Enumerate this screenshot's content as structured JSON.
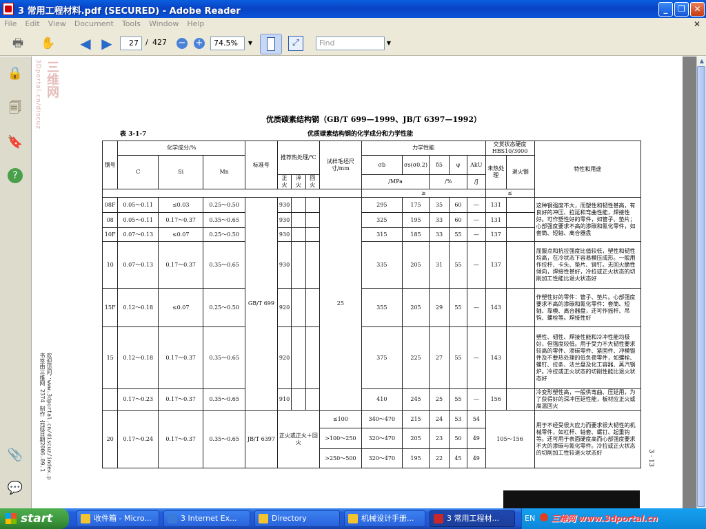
{
  "window": {
    "title": "3 常用工程材料.pdf (SECURED) - Adobe Reader",
    "min": "_",
    "max": "❐",
    "close": "✕"
  },
  "menu": [
    "File",
    "Edit",
    "View",
    "Document",
    "Tools",
    "Window",
    "Help"
  ],
  "toolbar": {
    "page_current": "27",
    "page_sep": "/",
    "page_total": "427",
    "zoom": "74.5%",
    "find_placeholder": "Find",
    "zoom_out": "−",
    "zoom_in": "+"
  },
  "watermark": {
    "side_url": "3Dportal.cn/discuz",
    "side_cn": "三维网",
    "bottom_left_1": "书签由三维网 2374 制作 完成日期2006.09.1",
    "bottom_left_2": "欢迎访问：www.3dportal.cn/discuz/index.p",
    "page_number": "3 · 13"
  },
  "doc": {
    "title": "优质碳素结构钢（GB/T 699—1999、JB/T 6397—1992）",
    "table_no": "表 3-1-7",
    "table_title": "优质碳素结构钢的化学成分和力学性能",
    "hdr": {
      "steel": "钢号",
      "chem": "化学成分/%",
      "c": "C",
      "si": "Si",
      "mn": "Mn",
      "std": "标准号",
      "heat": "推荐热处理/℃",
      "normal": "正火",
      "quench": "淬火",
      "temper": "回火",
      "size": "试样毛坯尺寸/mm",
      "mech": "力学性能",
      "sb": "σb",
      "ss": "σs(σ0.2)",
      "d5": "δ5",
      "psi": "ψ",
      "aku": "AkU",
      "mpa": "/MPa",
      "pct": "/%",
      "j": "/J",
      "ge": "≥",
      "hbs": "交货状态硬度HBS10/3000",
      "unh": "未热处理",
      "ann": "退火钢",
      "le": "≤",
      "use": "特性和用途"
    },
    "rows": [
      {
        "steel": "08F",
        "c": "0.05～0.11",
        "si": "≤0.03",
        "mn": "0.25～0.50",
        "norm": "930",
        "sb": "295",
        "ss": "175",
        "d5": "35",
        "psi": "60",
        "aku": "—",
        "h1": "131",
        "use": "这种钢强度不大，而塑性和韧性甚高，有良好的冲压、拉延和弯曲性能，焊接性好。可作塑性好的零件，如管子、垫片；心部强度要求不高的渗碳和氰化零件，如套筒、短轴、离合器盘"
      },
      {
        "steel": "08",
        "c": "0.05～0.11",
        "si": "0.17～0.37",
        "mn": "0.35～0.65",
        "norm": "930",
        "sb": "325",
        "ss": "195",
        "d5": "33",
        "psi": "60",
        "aku": "—",
        "h1": "131"
      },
      {
        "steel": "10F",
        "c": "0.07～0.13",
        "si": "≤0.07",
        "mn": "0.25～0.50",
        "norm": "930",
        "sb": "315",
        "ss": "185",
        "d5": "33",
        "psi": "55",
        "aku": "—",
        "h1": "137"
      },
      {
        "steel": "10",
        "c": "0.07～0.13",
        "si": "0.17～0.37",
        "mn": "0.35～0.65",
        "norm": "930",
        "sb": "335",
        "ss": "205",
        "d5": "31",
        "psi": "55",
        "aku": "—",
        "h1": "137",
        "use": "屈服点和抗拉强度比值较低，塑性和韧性均高，在冷状态下容易模压成形。一般用作拉杆、卡头、垫片、铆钉。无回火脆性倾向，焊接性甚好，冷拉或正火状态的切削加工性能比退火状态好"
      },
      {
        "steel": "15F",
        "c": "0.12～0.18",
        "si": "≤0.07",
        "mn": "0.25～0.50",
        "norm": "920",
        "sb": "355",
        "ss": "205",
        "d5": "29",
        "psi": "55",
        "aku": "—",
        "h1": "143",
        "use": "作塑性好的零件：管子、垫片。心部强度要求不高的渗碳和氰化零件：套筒、短轴、靠模、离合器盘，还可作摇杆、吊钩、螺栓等。焊接性好"
      },
      {
        "steel": "15",
        "c": "0.12～0.18",
        "si": "0.17～0.37",
        "mn": "0.35～0.65",
        "norm": "920",
        "sb": "375",
        "ss": "225",
        "d5": "27",
        "psi": "55",
        "aku": "—",
        "h1": "143",
        "use": "塑性、韧性、焊接性能和冷冲性能均极好，但强度较低。用于受力不大韧性要求较高的零件、渗碳零件、紧固件、冲模锻件及不要热处理的低负荷零件，如螺栓、螺钉、拉条、法兰盘及化工容器、蒸汽锅炉。冷拉或正火状态的切削性能比退火状态好"
      },
      {
        "steel": "",
        "c": "0.17～0.23",
        "si": "0.17～0.37",
        "mn": "0.35～0.65",
        "norm": "910",
        "sb": "410",
        "ss": "245",
        "d5": "25",
        "psi": "55",
        "aku": "—",
        "h1": "156",
        "use": "冷变形塑性高，一般供弯曲、压延用，为了获得好的深冲压延性能，板材应正火或高温回火"
      },
      {
        "steel": "20",
        "c": "0.17～0.24",
        "si": "0.17～0.37",
        "mn": "0.35～0.65",
        "std": "JB/T 6397",
        "heat": "正火或正火＋回火",
        "h": "105～156",
        "use": "用于不经受很大应力而要求很大韧性的机械零件，如杠杆、轴套、螺钉、起重钩等。还可用于表面硬度高而心部强度要求不大的渗碳与氰化零件。冷拉或正火状态的切削加工性较退火状态好",
        "sub": [
          {
            "size": "≤100",
            "sb": "340～470",
            "ss": "215",
            "d5": "24",
            "psi": "53",
            "aku": "54"
          },
          {
            "size": ">100～250",
            "sb": "320～470",
            "ss": "205",
            "d5": "23",
            "psi": "50",
            "aku": "49"
          },
          {
            "size": ">250～500",
            "sb": "320～470",
            "ss": "195",
            "d5": "22",
            "psi": "45",
            "aku": "49"
          }
        ]
      }
    ],
    "std_main": "GB/T 699",
    "size_main": "25"
  },
  "taskbar": {
    "start": "start",
    "tasks": [
      "收件箱 - Micro...",
      "3 Internet Ex...",
      "Directory",
      "机械设计手册...",
      "3 常用工程材..."
    ],
    "lang": "EN",
    "tray_wm": "三维网 www.3dportal.cn"
  },
  "colors": {
    "title_blue": "#0a54d8",
    "start_green": "#3c963c",
    "taskbar_blue": "#245edb"
  }
}
